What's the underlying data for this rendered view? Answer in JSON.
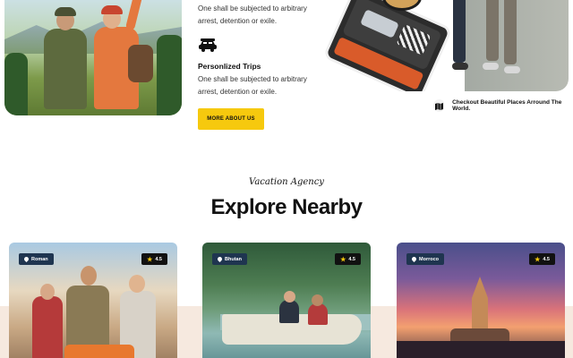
{
  "features": [
    {
      "title": "",
      "text_line1": "One shall be subjected to arbitrary",
      "text_line2": "arrest, detention or exile."
    },
    {
      "title": "Personlized Trips",
      "text_line1": "One shall be subjected to arbitrary",
      "text_line2": "arrest, detention or exile."
    }
  ],
  "more_button": "MORE ABOUT US",
  "checkout_text": "Checkout Beautiful Places Arround The World.",
  "section": {
    "subtitle": "Vacation Agency",
    "heading": "Explore Nearby"
  },
  "cards": [
    {
      "location": "Roman",
      "rating": "4.5"
    },
    {
      "location": "Bhutan",
      "rating": "4.5"
    },
    {
      "location": "Morroco",
      "rating": "4.5"
    }
  ],
  "colors": {
    "accent": "#f6c90e",
    "badge": "#1f3550",
    "band": "#f6e9df"
  },
  "icons": [
    "car-icon",
    "map-icon",
    "location-pin-icon",
    "star-icon"
  ]
}
